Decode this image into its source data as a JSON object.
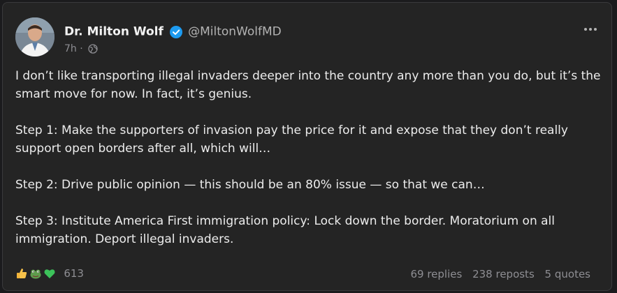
{
  "post": {
    "author": {
      "display_name": "Dr. Milton Wolf",
      "handle": "@MiltonWolfMD",
      "verified": true
    },
    "time": "7h",
    "separator": "·",
    "visibility_icon": "globe-icon",
    "more_icon": "more-options-icon",
    "body": {
      "p1": "I don’t like transporting illegal invaders deeper into the country any more than you do, but it’s the smart move for now. In fact, it’s genius.",
      "p2": "Step 1: Make the supporters of invasion pay the price for it and expose that they don’t really support open borders after all, which will…",
      "p3": "Step 2: Drive public opinion — this should be an 80% issue — so that we can…",
      "p4": "Step 3: Institute America First immigration policy: Lock down the border. Moratorium on all immigration. Deport illegal invaders."
    },
    "reactions": {
      "icons": [
        "thumbs-up-icon",
        "frog-icon",
        "green-heart-icon"
      ],
      "count": "613"
    },
    "stats": {
      "replies": "69 replies",
      "reposts": "238 reposts",
      "quotes": "5 quotes"
    }
  },
  "colors": {
    "background": "#1b1b1d",
    "card": "#242424",
    "verified": "#1d9bf0",
    "muted": "#8e8e93"
  }
}
